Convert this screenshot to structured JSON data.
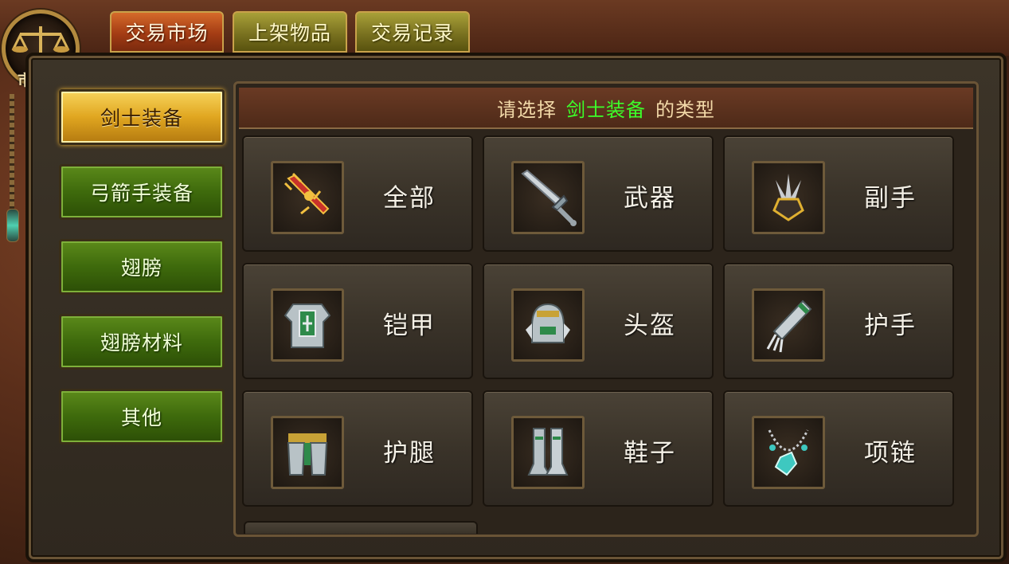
{
  "emblem": {
    "label": "市场"
  },
  "tabs": [
    {
      "label": "交易市场",
      "active": true
    },
    {
      "label": "上架物品",
      "active": false
    },
    {
      "label": "交易记录",
      "active": false
    }
  ],
  "categories": [
    {
      "label": "剑士装备",
      "selected": true
    },
    {
      "label": "弓箭手装备",
      "selected": false
    },
    {
      "label": "翅膀",
      "selected": false
    },
    {
      "label": "翅膀材料",
      "selected": false
    },
    {
      "label": "其他",
      "selected": false
    }
  ],
  "header": {
    "prefix": "请选择",
    "highlight": "剑士装备",
    "suffix": "的类型",
    "highlight_color": "#3cff2a"
  },
  "item_types": [
    {
      "label": "全部",
      "icon": "all-equipment-icon"
    },
    {
      "label": "武器",
      "icon": "sword-icon"
    },
    {
      "label": "副手",
      "icon": "offhand-claw-icon"
    },
    {
      "label": "铠甲",
      "icon": "armor-icon"
    },
    {
      "label": "头盔",
      "icon": "helmet-icon"
    },
    {
      "label": "护手",
      "icon": "gauntlet-icon"
    },
    {
      "label": "护腿",
      "icon": "leg-guard-icon"
    },
    {
      "label": "鞋子",
      "icon": "boots-icon"
    },
    {
      "label": "项链",
      "icon": "necklace-icon"
    }
  ],
  "colors": {
    "active_tab": "#a43c14",
    "inactive_tab": "#7a7220",
    "selected_category": "#e0a620",
    "category": "#3e6a0c"
  }
}
